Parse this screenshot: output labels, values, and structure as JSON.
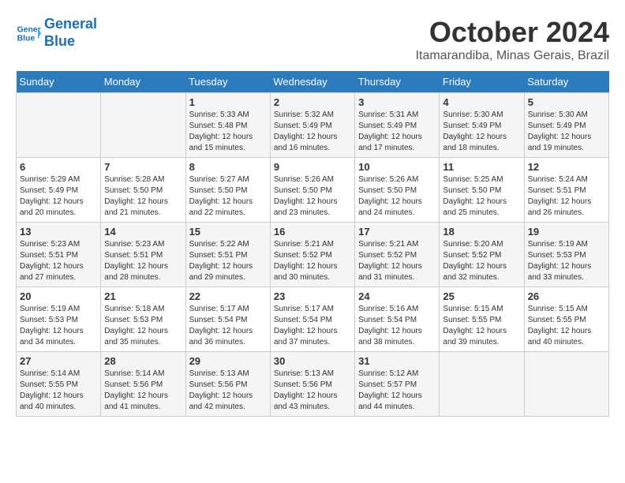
{
  "header": {
    "logo_line1": "General",
    "logo_line2": "Blue",
    "month": "October 2024",
    "location": "Itamarandiba, Minas Gerais, Brazil"
  },
  "weekdays": [
    "Sunday",
    "Monday",
    "Tuesday",
    "Wednesday",
    "Thursday",
    "Friday",
    "Saturday"
  ],
  "weeks": [
    [
      {
        "day": "",
        "info": ""
      },
      {
        "day": "",
        "info": ""
      },
      {
        "day": "1",
        "info": "Sunrise: 5:33 AM\nSunset: 5:48 PM\nDaylight: 12 hours and 15 minutes."
      },
      {
        "day": "2",
        "info": "Sunrise: 5:32 AM\nSunset: 5:49 PM\nDaylight: 12 hours and 16 minutes."
      },
      {
        "day": "3",
        "info": "Sunrise: 5:31 AM\nSunset: 5:49 PM\nDaylight: 12 hours and 17 minutes."
      },
      {
        "day": "4",
        "info": "Sunrise: 5:30 AM\nSunset: 5:49 PM\nDaylight: 12 hours and 18 minutes."
      },
      {
        "day": "5",
        "info": "Sunrise: 5:30 AM\nSunset: 5:49 PM\nDaylight: 12 hours and 19 minutes."
      }
    ],
    [
      {
        "day": "6",
        "info": "Sunrise: 5:29 AM\nSunset: 5:49 PM\nDaylight: 12 hours and 20 minutes."
      },
      {
        "day": "7",
        "info": "Sunrise: 5:28 AM\nSunset: 5:50 PM\nDaylight: 12 hours and 21 minutes."
      },
      {
        "day": "8",
        "info": "Sunrise: 5:27 AM\nSunset: 5:50 PM\nDaylight: 12 hours and 22 minutes."
      },
      {
        "day": "9",
        "info": "Sunrise: 5:26 AM\nSunset: 5:50 PM\nDaylight: 12 hours and 23 minutes."
      },
      {
        "day": "10",
        "info": "Sunrise: 5:26 AM\nSunset: 5:50 PM\nDaylight: 12 hours and 24 minutes."
      },
      {
        "day": "11",
        "info": "Sunrise: 5:25 AM\nSunset: 5:50 PM\nDaylight: 12 hours and 25 minutes."
      },
      {
        "day": "12",
        "info": "Sunrise: 5:24 AM\nSunset: 5:51 PM\nDaylight: 12 hours and 26 minutes."
      }
    ],
    [
      {
        "day": "13",
        "info": "Sunrise: 5:23 AM\nSunset: 5:51 PM\nDaylight: 12 hours and 27 minutes."
      },
      {
        "day": "14",
        "info": "Sunrise: 5:23 AM\nSunset: 5:51 PM\nDaylight: 12 hours and 28 minutes."
      },
      {
        "day": "15",
        "info": "Sunrise: 5:22 AM\nSunset: 5:51 PM\nDaylight: 12 hours and 29 minutes."
      },
      {
        "day": "16",
        "info": "Sunrise: 5:21 AM\nSunset: 5:52 PM\nDaylight: 12 hours and 30 minutes."
      },
      {
        "day": "17",
        "info": "Sunrise: 5:21 AM\nSunset: 5:52 PM\nDaylight: 12 hours and 31 minutes."
      },
      {
        "day": "18",
        "info": "Sunrise: 5:20 AM\nSunset: 5:52 PM\nDaylight: 12 hours and 32 minutes."
      },
      {
        "day": "19",
        "info": "Sunrise: 5:19 AM\nSunset: 5:53 PM\nDaylight: 12 hours and 33 minutes."
      }
    ],
    [
      {
        "day": "20",
        "info": "Sunrise: 5:19 AM\nSunset: 5:53 PM\nDaylight: 12 hours and 34 minutes."
      },
      {
        "day": "21",
        "info": "Sunrise: 5:18 AM\nSunset: 5:53 PM\nDaylight: 12 hours and 35 minutes."
      },
      {
        "day": "22",
        "info": "Sunrise: 5:17 AM\nSunset: 5:54 PM\nDaylight: 12 hours and 36 minutes."
      },
      {
        "day": "23",
        "info": "Sunrise: 5:17 AM\nSunset: 5:54 PM\nDaylight: 12 hours and 37 minutes."
      },
      {
        "day": "24",
        "info": "Sunrise: 5:16 AM\nSunset: 5:54 PM\nDaylight: 12 hours and 38 minutes."
      },
      {
        "day": "25",
        "info": "Sunrise: 5:15 AM\nSunset: 5:55 PM\nDaylight: 12 hours and 39 minutes."
      },
      {
        "day": "26",
        "info": "Sunrise: 5:15 AM\nSunset: 5:55 PM\nDaylight: 12 hours and 40 minutes."
      }
    ],
    [
      {
        "day": "27",
        "info": "Sunrise: 5:14 AM\nSunset: 5:55 PM\nDaylight: 12 hours and 40 minutes."
      },
      {
        "day": "28",
        "info": "Sunrise: 5:14 AM\nSunset: 5:56 PM\nDaylight: 12 hours and 41 minutes."
      },
      {
        "day": "29",
        "info": "Sunrise: 5:13 AM\nSunset: 5:56 PM\nDaylight: 12 hours and 42 minutes."
      },
      {
        "day": "30",
        "info": "Sunrise: 5:13 AM\nSunset: 5:56 PM\nDaylight: 12 hours and 43 minutes."
      },
      {
        "day": "31",
        "info": "Sunrise: 5:12 AM\nSunset: 5:57 PM\nDaylight: 12 hours and 44 minutes."
      },
      {
        "day": "",
        "info": ""
      },
      {
        "day": "",
        "info": ""
      }
    ]
  ]
}
